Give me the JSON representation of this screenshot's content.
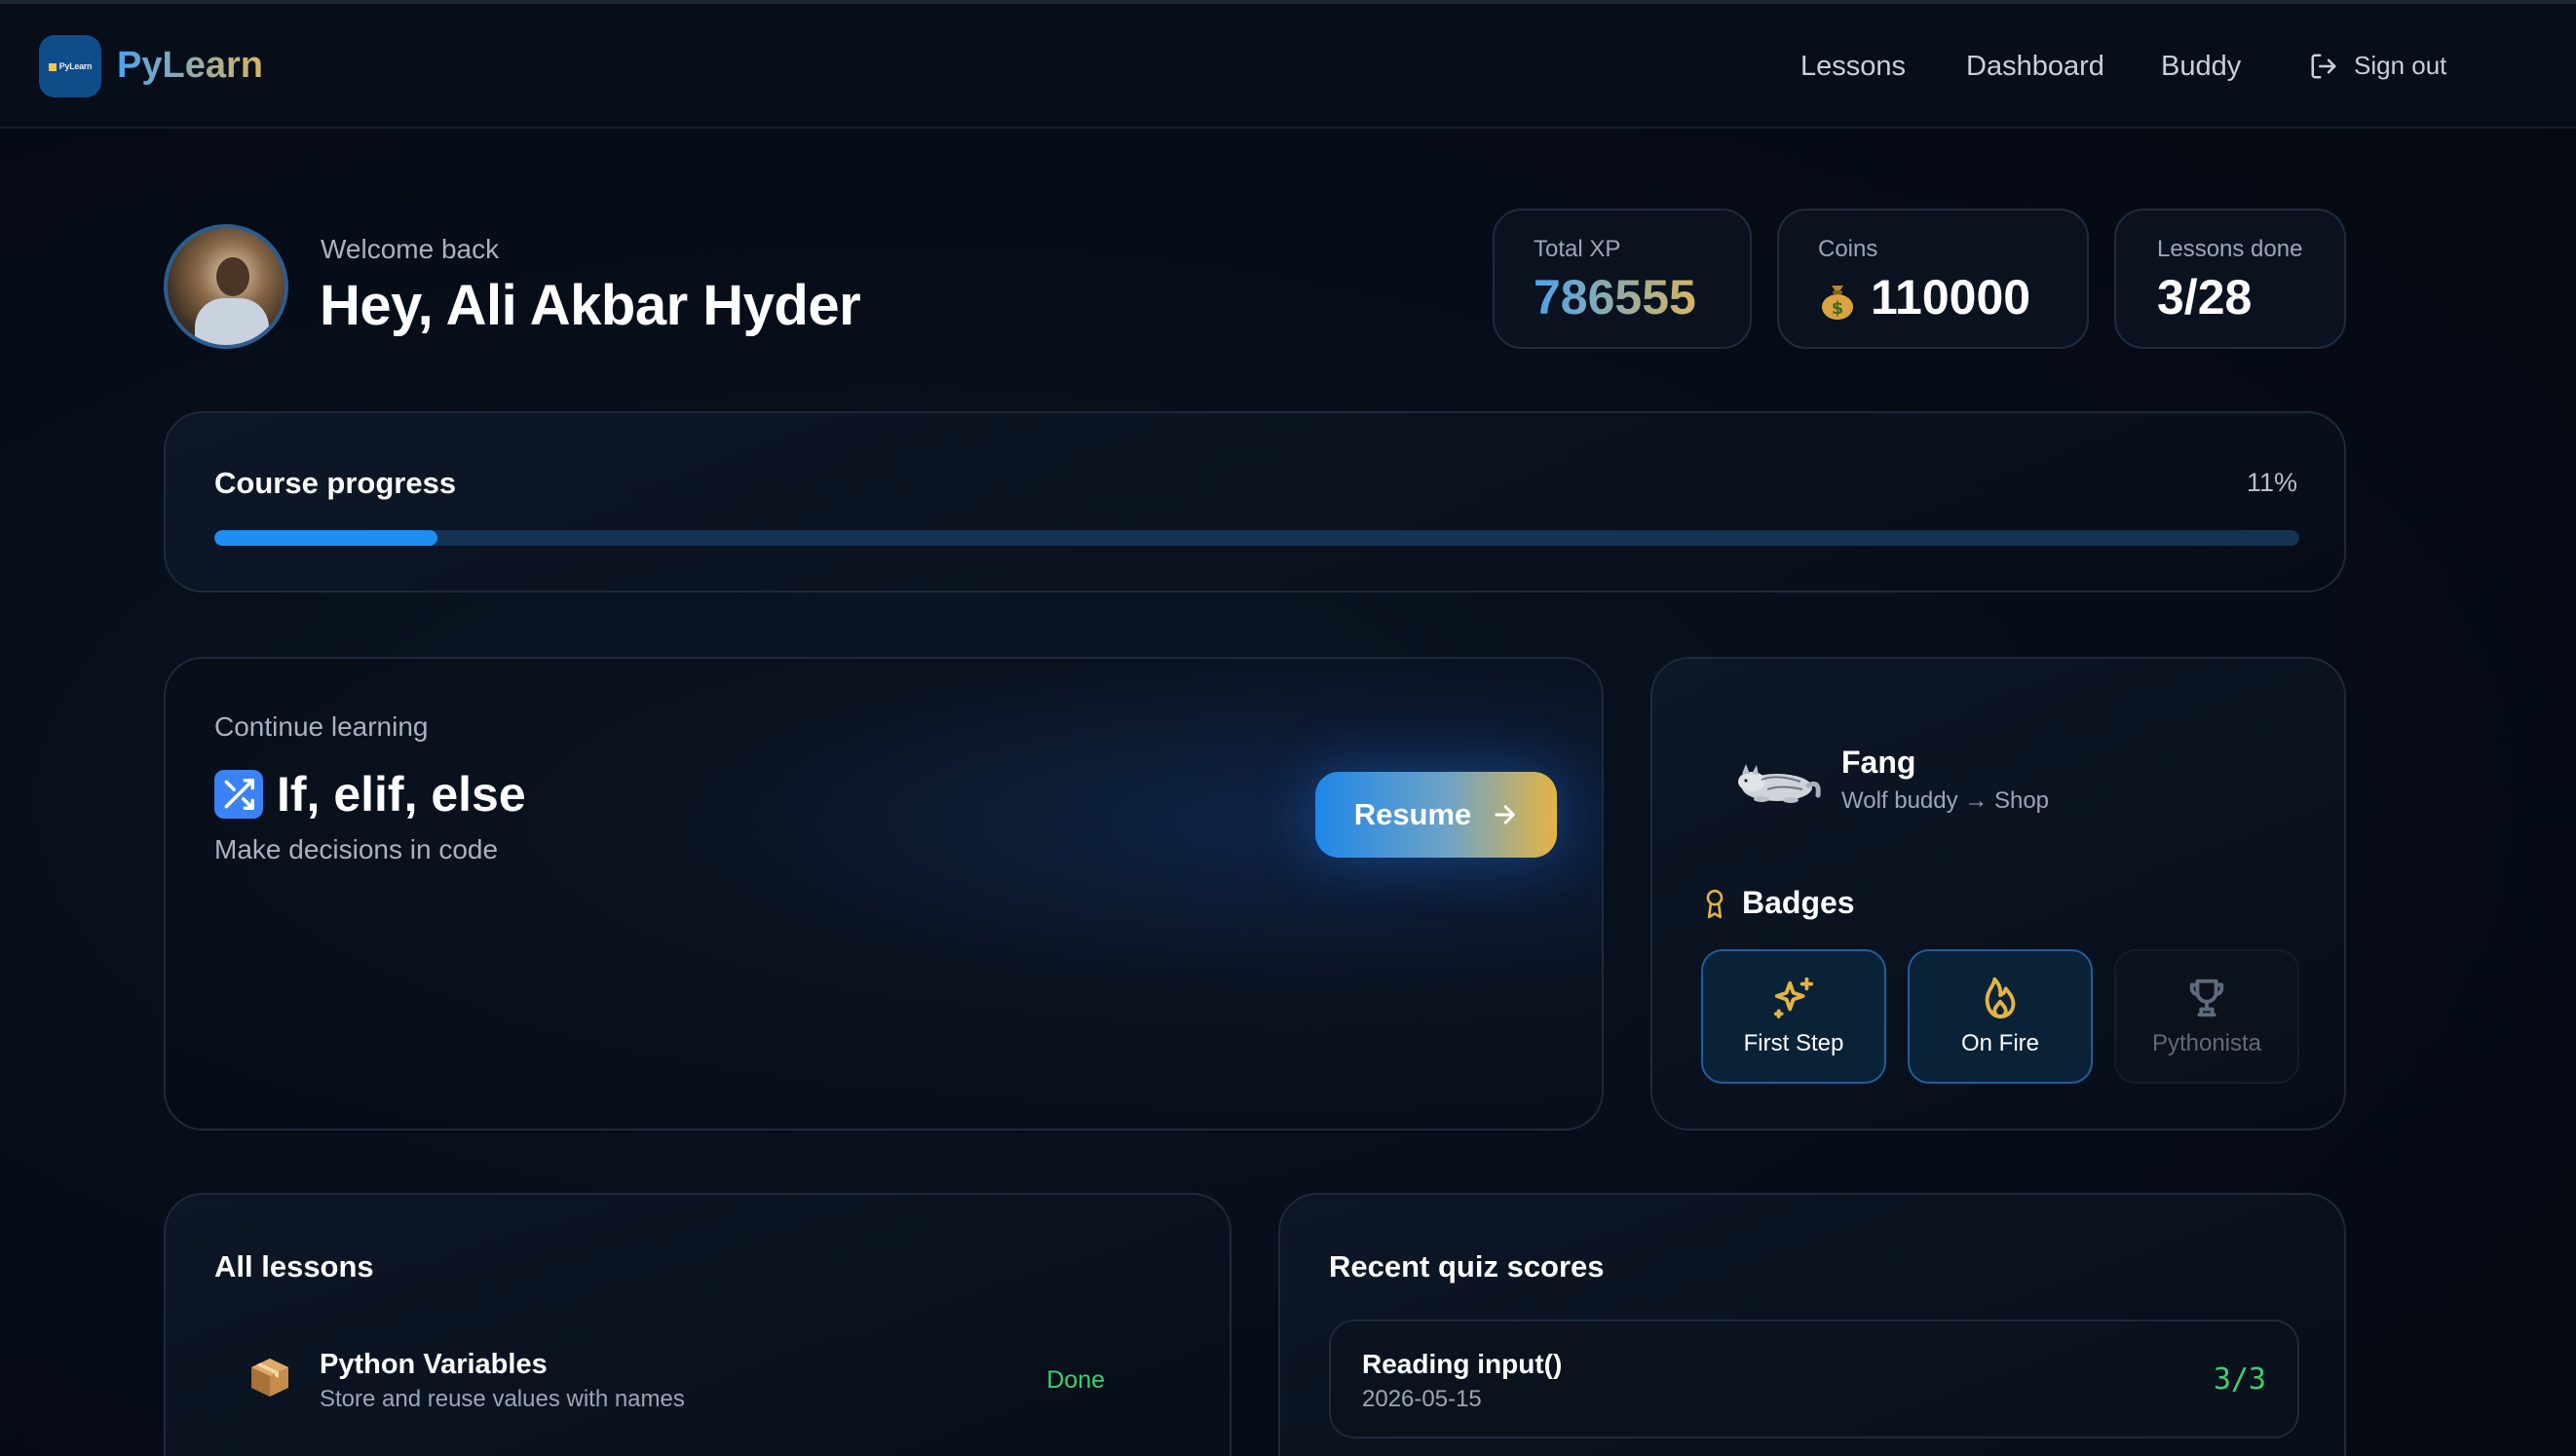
{
  "app": {
    "brand": "PyLearn",
    "logo_mini_text": "PyLearn"
  },
  "nav": {
    "links": [
      "Lessons",
      "Dashboard",
      "Buddy"
    ],
    "signout_label": "Sign out"
  },
  "header": {
    "welcome": "Welcome back",
    "greeting": "Hey, Ali Akbar Hyder"
  },
  "stats": {
    "xp": {
      "label": "Total XP",
      "value": "786555"
    },
    "coins": {
      "label": "Coins",
      "value": "110000",
      "icon": "money-bag-icon"
    },
    "lessons": {
      "label": "Lessons done",
      "value": "3/28"
    }
  },
  "progress": {
    "title": "Course progress",
    "percent_label": "11%",
    "fraction": 0.107
  },
  "continue": {
    "label": "Continue learning",
    "lesson_title": "If, elif, else",
    "lesson_icon": "shuffle-icon",
    "description": "Make decisions in code",
    "button": "Resume"
  },
  "buddy": {
    "name": "Fang",
    "subtitle": "Wolf buddy → Shop",
    "badges_title": "Badges",
    "badges": [
      {
        "label": "First Step",
        "icon": "sparkles-icon",
        "earned": true
      },
      {
        "label": "On Fire",
        "icon": "flame-icon",
        "earned": true
      },
      {
        "label": "Pythonista",
        "icon": "trophy-icon",
        "earned": false
      }
    ]
  },
  "lessons": {
    "title": "All lessons",
    "items": [
      {
        "title": "Python Variables",
        "subtitle": "Store and reuse values with names",
        "status": "Done",
        "icon": "box-icon"
      }
    ]
  },
  "recent": {
    "title": "Recent quiz scores",
    "items": [
      {
        "title": "Reading input()",
        "date": "2026-05-15",
        "score": "3/3"
      }
    ]
  },
  "colors": {
    "accent_blue": "#1e8ef2",
    "accent_gold": "#e3b443",
    "success": "#3ecf6e",
    "background": "#050a14"
  }
}
